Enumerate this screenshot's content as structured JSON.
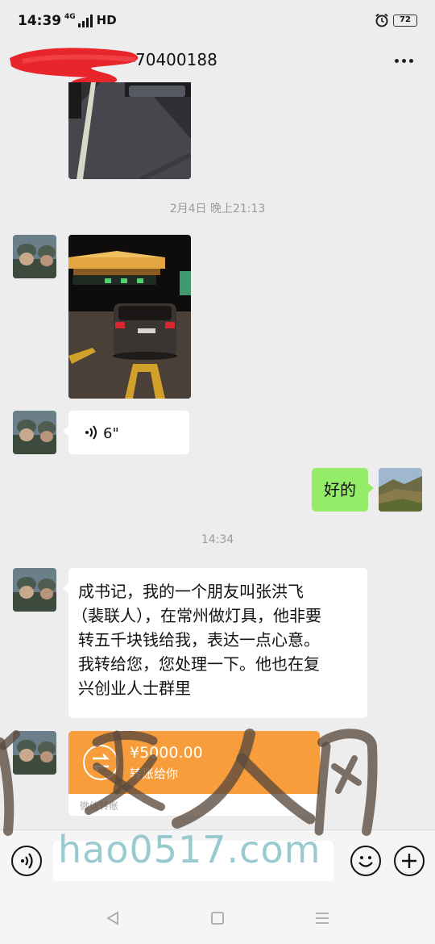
{
  "status_bar": {
    "time": "14:39",
    "network": "4G",
    "hd": "HD",
    "battery": "72"
  },
  "header": {
    "contact_name": "70400188",
    "more_icon": "more-dots-icon"
  },
  "chat": {
    "timestamp_1": "2月4日 晚上21:13",
    "voice_duration": "6\"",
    "reply_text": "好的",
    "timestamp_2": "14:34",
    "message_lines": [
      "成书记，我的一个朋友叫张洪飞",
      "（裴联人），在常州做灯具，他非要",
      "转五千块钱给我，表达一点心意。",
      "我转给您，您处理一下。他也在复",
      "兴创业人士群里"
    ],
    "transfer": {
      "amount": "¥5000.00",
      "note": "转账给你",
      "label": "微信转账"
    }
  },
  "watermark": {
    "site": "hao0517.com"
  },
  "colors": {
    "background": "#ededed",
    "bubble_sent": "#95ec69",
    "transfer": "#f79d3b"
  }
}
